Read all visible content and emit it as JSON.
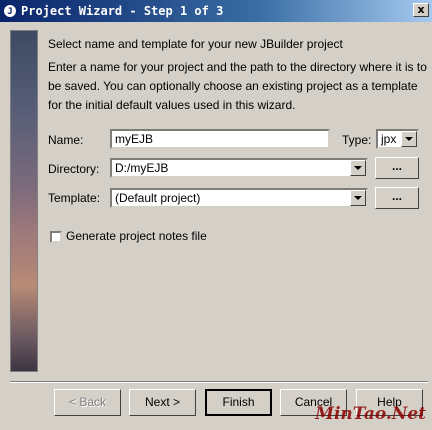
{
  "window": {
    "title": "Project Wizard - Step 1 of 3",
    "close_glyph": "x"
  },
  "heading": "Select name and template for your new JBuilder project",
  "description": "Enter a name for your project and the path to the directory where it is to\nbe saved. You can optionally choose an existing project as a template\nfor the initial default values used in this wizard.",
  "form": {
    "name_label": "Name:",
    "name_value": "myEJB",
    "type_label": "Type:",
    "type_value": "jpx",
    "directory_label": "Directory:",
    "directory_value": "D:/myEJB",
    "template_label": "Template:",
    "template_value": "(Default project)",
    "browse_label": "...",
    "notes_label": "Generate project notes file"
  },
  "buttons": {
    "back": "< Back",
    "next": "Next >",
    "finish": "Finish",
    "cancel": "Cancel",
    "help": "Help"
  },
  "watermark": "MinTao.Net"
}
